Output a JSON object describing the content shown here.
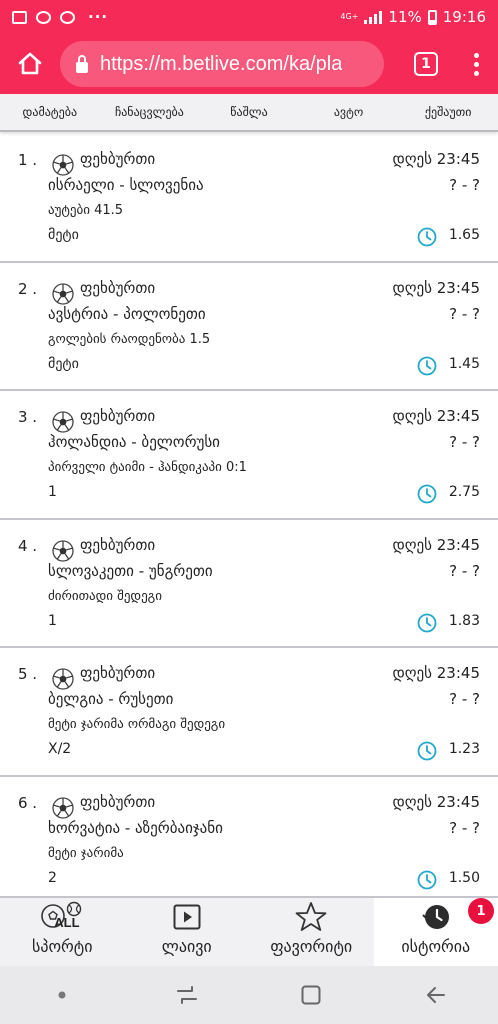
{
  "status_bar": {
    "network": "4G+",
    "battery": "11%",
    "time": "19:16",
    "left_icons": [
      "gallery-icon",
      "messenger-icon",
      "messenger-icon"
    ],
    "more_icon_text": "···"
  },
  "browser": {
    "url": "https://m.betlive.com/ka/pla",
    "tab_count": "1"
  },
  "tabs": [
    {
      "label": "დამატება"
    },
    {
      "label": "ჩანაცვლება"
    },
    {
      "label": "წაშლა"
    },
    {
      "label": "ავტო"
    },
    {
      "label": "ქეშაუთი"
    }
  ],
  "bets": [
    {
      "num": "1 .",
      "sport": "ფეხბურთი",
      "time": "დღეს 23:45",
      "match": "ისრაელი - სლოვენია",
      "score": "? - ?",
      "market": "აუტები 41.5",
      "pick": "მეტი",
      "odds": "1.65"
    },
    {
      "num": "2 .",
      "sport": "ფეხბურთი",
      "time": "დღეს 23:45",
      "match": "ავსტრია - პოლონეთი",
      "score": "? - ?",
      "market": "გოლების რაოდენობა 1.5",
      "pick": "მეტი",
      "odds": "1.45"
    },
    {
      "num": "3 .",
      "sport": "ფეხბურთი",
      "time": "დღეს 23:45",
      "match": "ჰოლანდია - ბელორუსი",
      "score": "? - ?",
      "market": "პირველი ტაიმი - ჰანდიკაპი 0:1",
      "pick": "1",
      "odds": "2.75"
    },
    {
      "num": "4 .",
      "sport": "ფეხბურთი",
      "time": "დღეს 23:45",
      "match": "სლოვაკეთი - უნგრეთი",
      "score": "? - ?",
      "market": "ძირითადი შედეგი",
      "pick": "1",
      "odds": "1.83"
    },
    {
      "num": "5 .",
      "sport": "ფეხბურთი",
      "time": "დღეს 23:45",
      "match": "ბელგია - რუსეთი",
      "score": "? - ?",
      "market": "მეტი ჯარიმა ორმაგი შედეგი",
      "pick": "X/2",
      "odds": "1.23"
    },
    {
      "num": "6 .",
      "sport": "ფეხბურთი",
      "time": "დღეს 23:45",
      "match": "ხორვატია - აზერბაიჯანი",
      "score": "? - ?",
      "market": "მეტი ჯარიმა",
      "pick": "2",
      "odds": "1.50"
    }
  ],
  "bottom_nav": {
    "sports": {
      "label": "სპორტი",
      "icon_text": "ALL"
    },
    "live": {
      "label": "ლაივი"
    },
    "favorites": {
      "label": "ფავორიტი"
    },
    "history": {
      "label": "ისტორია",
      "badge": "1"
    }
  },
  "colors": {
    "brand": "#f52a56",
    "badge": "#e8113e",
    "clock": "#22a9c9"
  }
}
